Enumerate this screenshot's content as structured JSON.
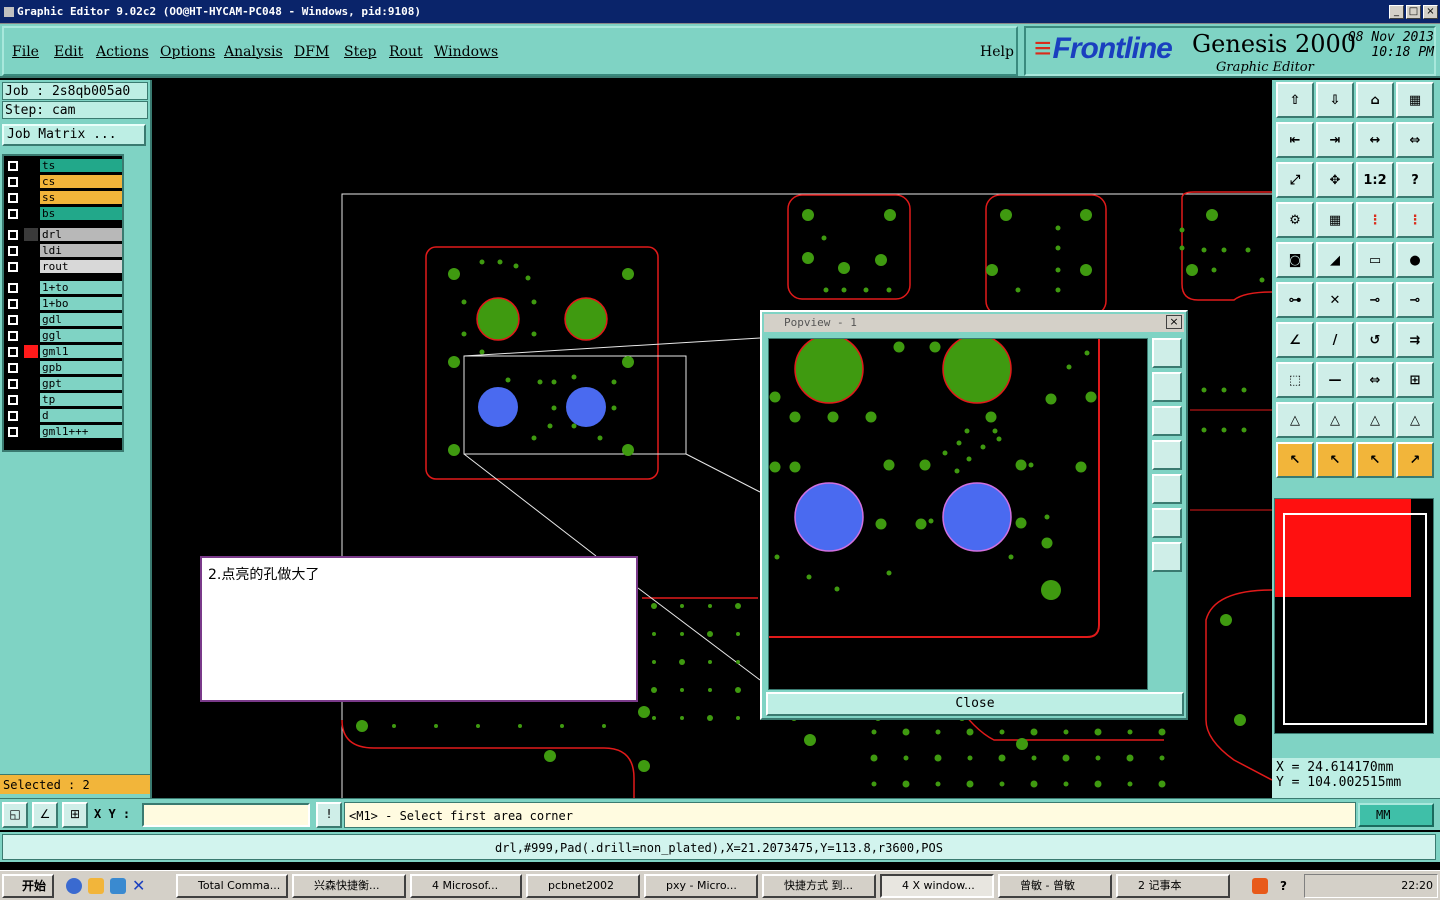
{
  "window": {
    "title": "Graphic Editor 9.02c2 (OO@HT-HYCAM-PC048 - Windows, pid:9108)",
    "controls": [
      "_",
      "□",
      "×"
    ]
  },
  "menu": {
    "items": [
      "File",
      "Edit",
      "Actions",
      "Options",
      "Analysis",
      "DFM",
      "Step",
      "Rout",
      "Windows"
    ],
    "help": "Help"
  },
  "branding": {
    "company": "Frontline",
    "product": "Genesis 2000",
    "module": "Graphic Editor",
    "date": "08 Nov 2013",
    "time": "10:18 PM"
  },
  "job": {
    "job_label": "Job : 2s8qb005a0",
    "step_label": "Step: cam",
    "matrix_button": "Job Matrix ..."
  },
  "layers": [
    {
      "name": "ts",
      "color": "#22a88a"
    },
    {
      "name": "cs",
      "color": "#f2b53a"
    },
    {
      "name": "ss",
      "color": "#f2b53a"
    },
    {
      "name": "bs",
      "color": "#22a88a"
    },
    {
      "name": "drl",
      "color": "#b8b8b8",
      "marker": "#3a3a3a"
    },
    {
      "name": "ldi",
      "color": "#b8b8b8"
    },
    {
      "name": "rout",
      "color": "#d8d8d8"
    },
    {
      "name": "1+to",
      "color": "#7fd3c4"
    },
    {
      "name": "1+bo",
      "color": "#7fd3c4"
    },
    {
      "name": "gdl",
      "color": "#7fd3c4"
    },
    {
      "name": "ggl",
      "color": "#7fd3c4"
    },
    {
      "name": "gml1",
      "color": "#7fd3c4",
      "marker": "#ff1a1a"
    },
    {
      "name": "gpb",
      "color": "#7fd3c4"
    },
    {
      "name": "gpt",
      "color": "#7fd3c4"
    },
    {
      "name": "tp",
      "color": "#7fd3c4"
    },
    {
      "name": "d",
      "color": "#7fd3c4"
    },
    {
      "name": "gml1+++",
      "color": "#7fd3c4"
    }
  ],
  "selected": "Selected : 2",
  "note": "2.点亮的孔做大了",
  "popview": {
    "title": "Popview - 1",
    "close_label": "Close"
  },
  "coords": {
    "x": "X  =  24.614170mm",
    "y": "Y  =  104.002515mm"
  },
  "command": {
    "xy_label": "X Y :",
    "xy_value": "",
    "prompt": "<M1> - Select first area corner",
    "units": "MM"
  },
  "status_info": "drl,#999,Pad(.drill=non_plated),X=21.2073475,Y=113.8,r3600,POS",
  "taskbar": {
    "start": "开始",
    "tasks": [
      "Total Comma...",
      "兴森快捷衡...",
      "4 Microsof...",
      "pcbnet2002",
      "pxy - Micro...",
      "快捷方式 到...",
      "4 X window...",
      "曾敏 - 曾敏",
      "2 记事本"
    ],
    "clock": "22:20"
  },
  "colors": {
    "pad_green": "#3f9a10",
    "pad_blue": "#4a6af0",
    "outline_red": "#e11a1a",
    "panel": "#7fd3c4"
  }
}
